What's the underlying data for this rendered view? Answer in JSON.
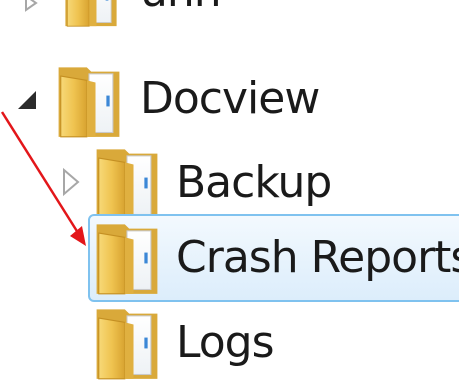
{
  "tree": {
    "items": [
      {
        "label": "unn"
      },
      {
        "label": "Docview"
      },
      {
        "label": "Backup"
      },
      {
        "label": "Crash Reports"
      },
      {
        "label": "Logs"
      }
    ]
  },
  "colors": {
    "selection_border": "#7fc2ef",
    "selection_fill": "#dcedfb",
    "arrow": "#e3161a",
    "folder": "#f0c64e"
  },
  "icons": {
    "folder": "folder-icon",
    "expanded": "expanded-triangle-icon",
    "collapsed": "collapsed-triangle-icon",
    "arrow": "red-arrow-icon"
  }
}
